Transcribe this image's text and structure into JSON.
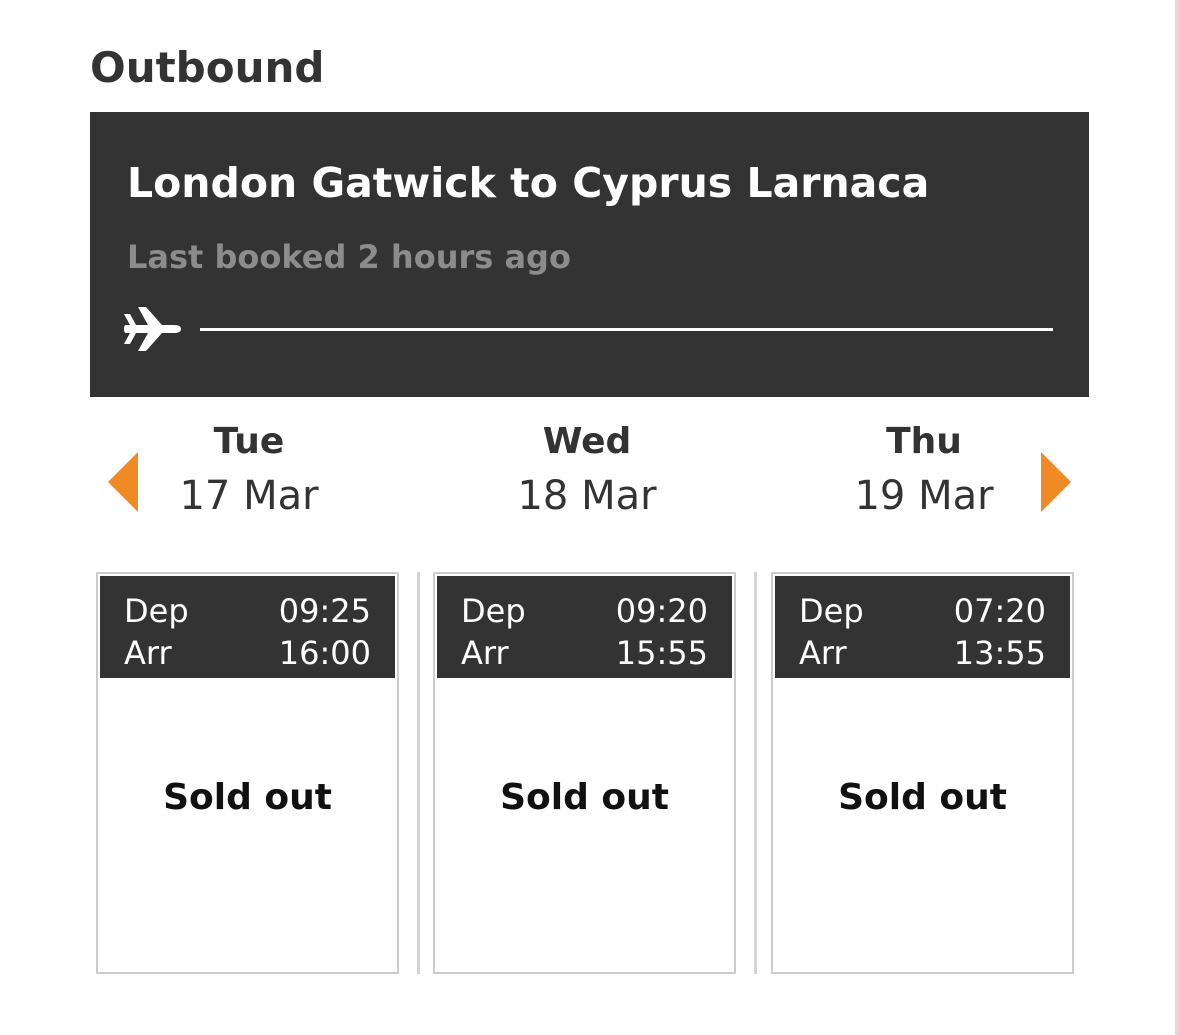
{
  "section": {
    "title": "Outbound"
  },
  "route": {
    "title": "London Gatwick to Cyprus Larnaca",
    "last_booked": "Last booked 2 hours ago",
    "icon": "plane-icon"
  },
  "navigation": {
    "prev_icon": "triangle-left-icon",
    "next_icon": "triangle-right-icon",
    "accent_color": "#f08a24"
  },
  "days": [
    {
      "day": "Tue",
      "date": "17 Mar",
      "dep_label": "Dep",
      "dep_time": "09:25",
      "arr_label": "Arr",
      "arr_time": "16:00",
      "status": "Sold out"
    },
    {
      "day": "Wed",
      "date": "18 Mar",
      "dep_label": "Dep",
      "dep_time": "09:20",
      "arr_label": "Arr",
      "arr_time": "15:55",
      "status": "Sold out"
    },
    {
      "day": "Thu",
      "date": "19 Mar",
      "dep_label": "Dep",
      "dep_time": "07:20",
      "arr_label": "Arr",
      "arr_time": "13:55",
      "status": "Sold out"
    }
  ],
  "colors": {
    "panel": "#333333",
    "accent": "#f08a24",
    "muted_text": "#8c8c8c",
    "card_border": "#cccccc"
  }
}
